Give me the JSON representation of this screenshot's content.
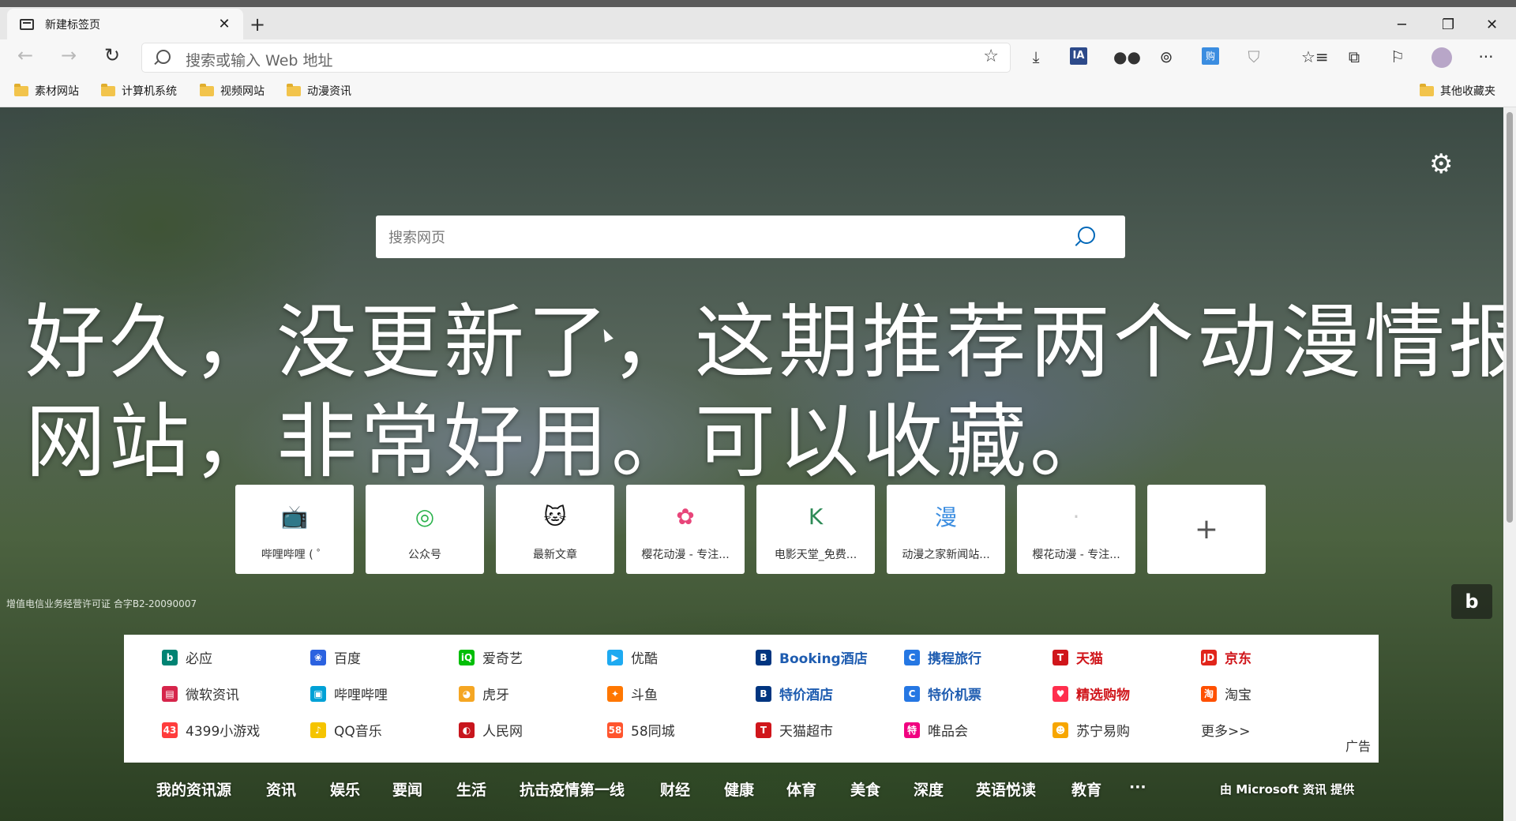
{
  "tab": {
    "title": "新建标签页",
    "close": "✕",
    "new": "+"
  },
  "window": {
    "minimize": "─",
    "restore": "❐",
    "close": "✕"
  },
  "toolbar": {
    "back": "←",
    "forward": "→",
    "refresh": "↻",
    "address_placeholder": "搜索或输入 Web 地址",
    "star": "☆",
    "download": "⤓",
    "more": "···",
    "ext_ia": "IA",
    "ext_favorites": "☆≡",
    "ext_collections": "⧉",
    "ext_feedback": "⚐"
  },
  "bookmarks": {
    "items": [
      "素材网站",
      "计算机系统",
      "视频网站",
      "动漫资讯"
    ],
    "other": "其他收藏夹"
  },
  "newtab": {
    "settings_icon": "⚙",
    "search_placeholder": "搜索网页",
    "overlay_line1": "好久，没更新了，这期推荐两个动漫情报类",
    "overlay_line2": "网站，非常好用。可以收藏。",
    "license": "增值电信业务经营许可证 合字B2-20090007",
    "bing_button": "b"
  },
  "tiles": [
    {
      "label": "哔哩哔哩 ( ゜",
      "icon": "bilibili-icon",
      "glyph": "📺",
      "color": "#00a1d6"
    },
    {
      "label": "公众号",
      "icon": "wechat-icon",
      "glyph": "◎",
      "color": "#2bb24c"
    },
    {
      "label": "最新文章",
      "icon": "cat-icon",
      "glyph": "🐱",
      "color": "#111111"
    },
    {
      "label": "樱花动漫 - 专注...",
      "icon": "sakura-icon",
      "glyph": "✿",
      "color": "#e8457a"
    },
    {
      "label": "电影天堂_免费...",
      "icon": "k-icon",
      "glyph": "K",
      "color": "#2e8b57"
    },
    {
      "label": "动漫之家新闻站...",
      "icon": "comic-icon",
      "glyph": "漫",
      "color": "#3b8de0"
    },
    {
      "label": "樱花动漫 - 专注...",
      "icon": "sakura-dot-icon",
      "glyph": "·",
      "color": "#cccccc"
    },
    {
      "label": "",
      "icon": "add-icon",
      "glyph": "+",
      "color": "#555555"
    }
  ],
  "links": [
    {
      "text": "必应",
      "icon": "b",
      "bg": "#008373",
      "style": ""
    },
    {
      "text": "百度",
      "icon": "❀",
      "bg": "#2b62e0",
      "style": ""
    },
    {
      "text": "爱奇艺",
      "icon": "iQ",
      "bg": "#00be06",
      "style": ""
    },
    {
      "text": "优酷",
      "icon": "▶",
      "bg": "#1eaaf1",
      "style": ""
    },
    {
      "text": "Booking酒店",
      "icon": "B",
      "bg": "#003580",
      "style": "blue"
    },
    {
      "text": "携程旅行",
      "icon": "C",
      "bg": "#2577e3",
      "style": "blue"
    },
    {
      "text": "天猫",
      "icon": "T",
      "bg": "#d0161b",
      "style": "red"
    },
    {
      "text": "京东",
      "icon": "JD",
      "bg": "#e1251b",
      "style": "red"
    },
    {
      "text": "微软资讯",
      "icon": "▤",
      "bg": "#d6254b",
      "style": ""
    },
    {
      "text": "哔哩哔哩",
      "icon": "▣",
      "bg": "#00a1d6",
      "style": ""
    },
    {
      "text": "虎牙",
      "icon": "◕",
      "bg": "#f5a623",
      "style": ""
    },
    {
      "text": "斗鱼",
      "icon": "✦",
      "bg": "#ff7700",
      "style": ""
    },
    {
      "text": "特价酒店",
      "icon": "B",
      "bg": "#003580",
      "style": "blue"
    },
    {
      "text": "特价机票",
      "icon": "C",
      "bg": "#2577e3",
      "style": "blue"
    },
    {
      "text": "精选购物",
      "icon": "♥",
      "bg": "#ff2e4d",
      "style": "red"
    },
    {
      "text": "淘宝",
      "icon": "淘",
      "bg": "#ff5000",
      "style": ""
    },
    {
      "text": "4399小游戏",
      "icon": "43",
      "bg": "#ff3c3c",
      "style": ""
    },
    {
      "text": "QQ音乐",
      "icon": "♪",
      "bg": "#f5c400",
      "style": ""
    },
    {
      "text": "人民网",
      "icon": "◐",
      "bg": "#c8161d",
      "style": ""
    },
    {
      "text": "58同城",
      "icon": "58",
      "bg": "#ff552e",
      "style": ""
    },
    {
      "text": "天猫超市",
      "icon": "T",
      "bg": "#d0161b",
      "style": ""
    },
    {
      "text": "唯品会",
      "icon": "特",
      "bg": "#f10180",
      "style": ""
    },
    {
      "text": "苏宁易购",
      "icon": "☻",
      "bg": "#f7a600",
      "style": ""
    },
    {
      "text": "更多>>",
      "icon": "",
      "bg": "",
      "style": ""
    }
  ],
  "ad_label": "广告",
  "news_tabs": [
    "我的资讯源",
    "资讯",
    "娱乐",
    "要闻",
    "生活",
    "抗击疫情第一线",
    "财经",
    "健康",
    "体育",
    "美食",
    "深度",
    "英语悦读",
    "教育",
    "···"
  ],
  "news_provider": "由 Microsoft 资讯 提供"
}
